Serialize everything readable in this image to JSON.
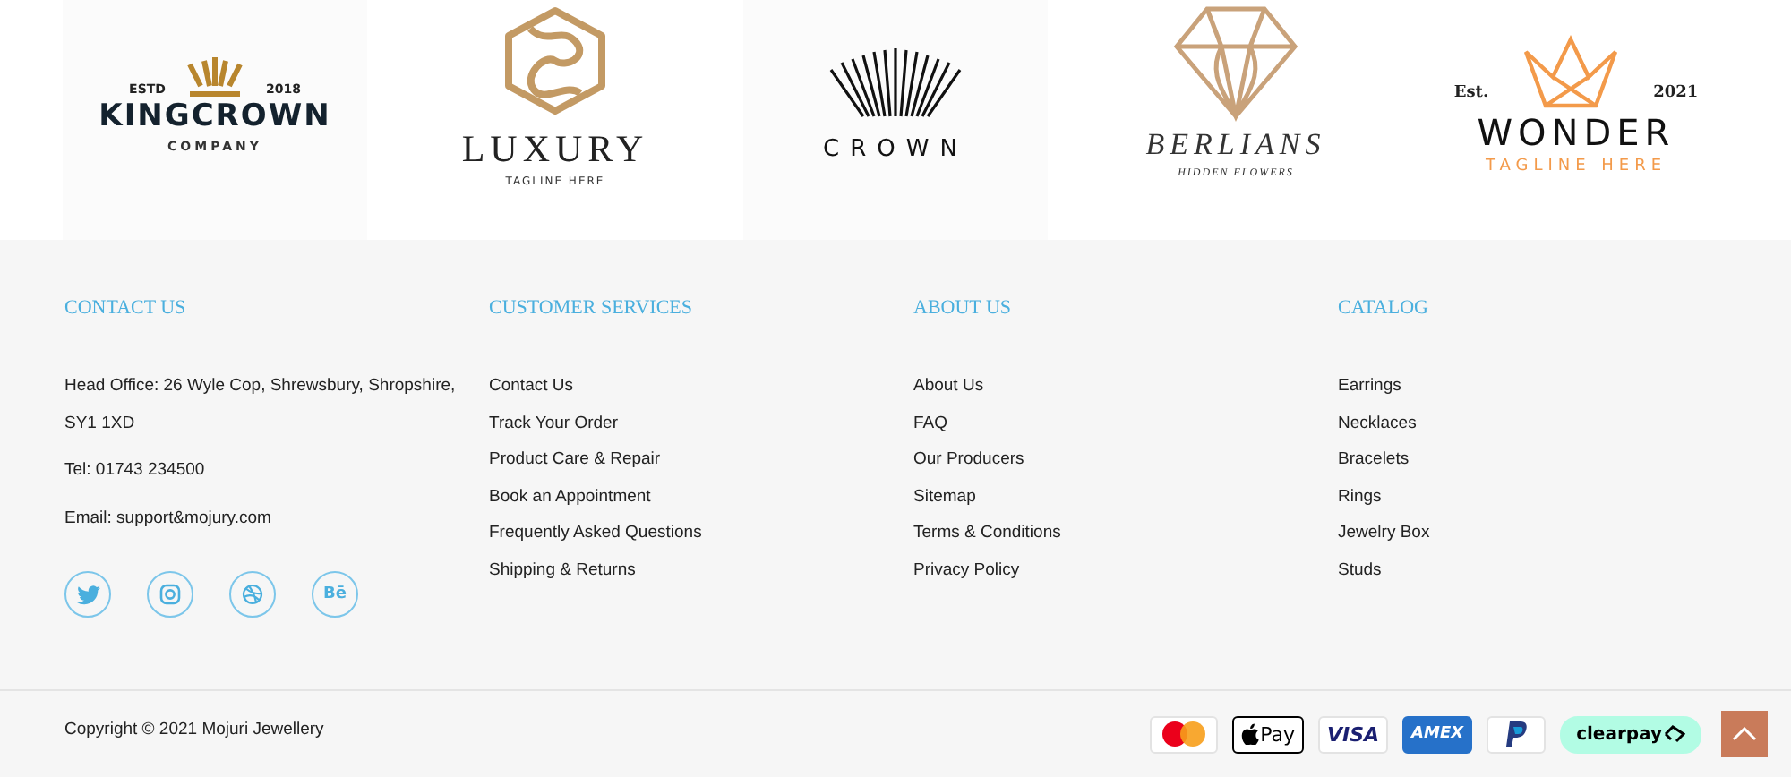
{
  "logos": [
    {
      "kind": "kingcrown",
      "est": "ESTD",
      "year": "2018",
      "name": "KINGCROWN",
      "tagline": "COMPANY"
    },
    {
      "kind": "luxury",
      "name": "LUXURY",
      "tagline": "TAGLINE HERE"
    },
    {
      "kind": "crown",
      "name": "CROWN"
    },
    {
      "kind": "berlians",
      "name": "BERLIANS",
      "tagline": "HIDDEN FLOWERS"
    },
    {
      "kind": "wonder",
      "est": "Est.",
      "year": "2021",
      "name": "WONDER",
      "tagline": "TAGLINE HERE"
    }
  ],
  "columns": [
    {
      "kind": "contact",
      "title": "CONTACT US",
      "lines": [
        "Head Office: 26 Wyle Cop, Shrewsbury, Shropshire, SY1 1XD",
        "Tel: 01743 234500",
        "Email: support&mojury.com"
      ],
      "social": [
        {
          "kind": "twitter"
        },
        {
          "kind": "instagram"
        },
        {
          "kind": "dribbble"
        },
        {
          "kind": "behance",
          "label": "Bē"
        }
      ]
    },
    {
      "kind": "links",
      "title": "CUSTOMER SERVICES",
      "links": [
        "Contact Us",
        "Track Your Order",
        "Product Care & Repair",
        "Book an Appointment",
        "Frequently Asked Questions",
        "Shipping & Returns"
      ]
    },
    {
      "kind": "links",
      "title": "ABOUT US",
      "links": [
        "About Us",
        "FAQ",
        "Our Producers",
        "Sitemap",
        "Terms & Conditions",
        "Privacy Policy"
      ]
    },
    {
      "kind": "links",
      "title": "CATALOG",
      "links": [
        "Earrings",
        "Necklaces",
        "Bracelets",
        "Rings",
        "Jewelry Box",
        "Studs"
      ]
    }
  ],
  "copyright": "Copyright © 2021 Mojuri Jewellery",
  "payments": [
    {
      "kind": "mastercard"
    },
    {
      "kind": "applepay",
      "label": "Pay"
    },
    {
      "kind": "visa",
      "label": "VISA"
    },
    {
      "kind": "amex",
      "label": "AMEX"
    },
    {
      "kind": "paypal"
    },
    {
      "kind": "clearpay",
      "label": "clearpay"
    }
  ]
}
